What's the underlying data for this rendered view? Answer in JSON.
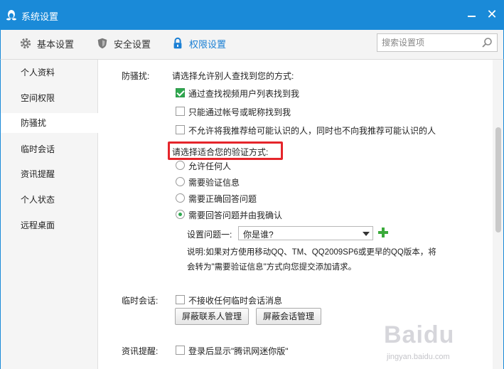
{
  "window": {
    "title": "系统设置",
    "accent_color": "#1a8ad8"
  },
  "toolbar": {
    "tabs": [
      {
        "label": "基本设置",
        "icon": "gear-icon"
      },
      {
        "label": "安全设置",
        "icon": "shield-icon"
      },
      {
        "label": "权限设置",
        "icon": "lock-icon",
        "active": true
      }
    ],
    "search": {
      "placeholder": "搜索设置项"
    }
  },
  "sidebar": {
    "items": [
      {
        "label": "个人资料"
      },
      {
        "label": "空间权限"
      },
      {
        "label": "防骚扰",
        "active": true
      },
      {
        "label": "临时会话"
      },
      {
        "label": "资讯提醒"
      },
      {
        "label": "个人状态"
      },
      {
        "label": "远程桌面"
      }
    ]
  },
  "anti_harass": {
    "section_label": "防骚扰:",
    "find_prompt": "请选择允许别人查找到您的方式:",
    "find_options": [
      {
        "label": "通过查找视频用户列表找到我",
        "checked": true
      },
      {
        "label": "只能通过帐号或昵称找到我",
        "checked": false
      },
      {
        "label": "不允许将我推荐给可能认识的人，同时也不向我推荐可能认识的人",
        "checked": false
      }
    ],
    "verify_prompt": "请选择适合您的验证方式:",
    "verify_options": [
      {
        "label": "允许任何人",
        "selected": false
      },
      {
        "label": "需要验证信息",
        "selected": false
      },
      {
        "label": "需要正确回答问题",
        "selected": false
      },
      {
        "label": "需要回答问题并由我确认",
        "selected": true
      }
    ],
    "question_label": "设置问题一:",
    "question_value": "你是谁?",
    "note_line1": "说明:如果对方使用移动QQ、TM、QQ2009SP6或更早的QQ版本，将",
    "note_line2": "会转为\"需要验证信息\"方式向您提交添加请求。"
  },
  "temp_session": {
    "section_label": "临时会话:",
    "option": {
      "label": "不接收任何临时会话消息",
      "checked": false
    },
    "buttons": [
      "屏蔽联系人管理",
      "屏蔽会话管理"
    ]
  },
  "news": {
    "section_label": "资讯提醒:",
    "option": {
      "label": "登录后显示\"腾讯网迷你版\"",
      "checked": false
    }
  },
  "watermark": {
    "brand": "Baidu",
    "sub": "jingyan.baidu.com"
  }
}
